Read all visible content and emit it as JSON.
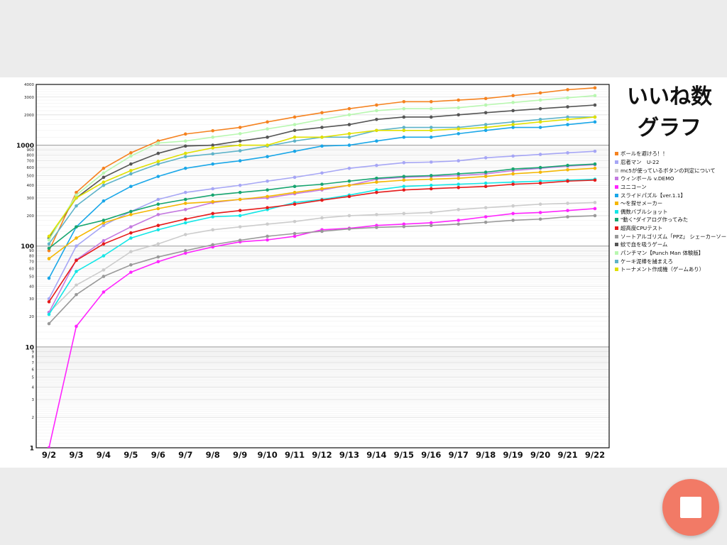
{
  "header": {
    "title_line1": "いいね数",
    "title_line2": "グラフ"
  },
  "stop_button": {
    "icon": "stop-icon"
  },
  "chart_data": {
    "type": "line",
    "yscale": "log",
    "ylim": [
      1,
      4000
    ],
    "grid": true,
    "legend_position": "right",
    "major_ticks": [
      "1",
      "10",
      "100",
      "1000"
    ],
    "minor_ticks": [
      "2",
      "3",
      "4",
      "5",
      "6",
      "7",
      "8",
      "9",
      "20",
      "30",
      "40",
      "50",
      "60",
      "70",
      "80",
      "90",
      "200",
      "300",
      "400",
      "500",
      "600",
      "700",
      "800",
      "900",
      "2000",
      "3000",
      "4000"
    ],
    "categories": [
      "9/2",
      "9/3",
      "9/4",
      "9/5",
      "9/6",
      "9/7",
      "9/8",
      "9/9",
      "9/10",
      "9/11",
      "9/12",
      "9/13",
      "9/14",
      "9/15",
      "9/16",
      "9/17",
      "9/18",
      "9/19",
      "9/20",
      "9/21",
      "9/22"
    ],
    "series": [
      {
        "name": "ボールを避けろ！！",
        "color": "#f5821f",
        "values": [
          90,
          340,
          590,
          840,
          1100,
          1290,
          1390,
          1500,
          1700,
          1900,
          2100,
          2300,
          2500,
          2700,
          2700,
          2800,
          2900,
          3100,
          3300,
          3550,
          3700
        ]
      },
      {
        "name": "忍者マン　U-22",
        "color": "#a6a6f5",
        "values": [
          30,
          100,
          160,
          220,
          290,
          340,
          370,
          400,
          440,
          480,
          530,
          590,
          630,
          670,
          680,
          700,
          750,
          780,
          810,
          840,
          870
        ]
      },
      {
        "name": "mc5が使っているボタンの判定について",
        "color": "#cccccc",
        "values": [
          22,
          41,
          58,
          88,
          105,
          130,
          145,
          155,
          165,
          175,
          190,
          200,
          205,
          210,
          215,
          230,
          240,
          250,
          260,
          265,
          270
        ]
      },
      {
        "name": "ウィンボール v.DEMO",
        "color": "#c479e0",
        "values": [
          22,
          73,
          113,
          155,
          205,
          230,
          270,
          290,
          300,
          330,
          360,
          400,
          460,
          480,
          490,
          500,
          520,
          560,
          590,
          620,
          640
        ]
      },
      {
        "name": "ユニコーン",
        "color": "#ff24ff",
        "values": [
          1,
          16,
          35,
          55,
          70,
          85,
          98,
          110,
          115,
          125,
          145,
          150,
          160,
          165,
          170,
          180,
          195,
          210,
          215,
          225,
          235
        ]
      },
      {
        "name": "スライドパズル【ver.1.1】",
        "color": "#1aa7e8",
        "values": [
          48,
          155,
          280,
          390,
          490,
          590,
          650,
          700,
          770,
          870,
          980,
          1000,
          1100,
          1200,
          1200,
          1300,
          1400,
          1500,
          1500,
          1600,
          1700
        ]
      },
      {
        "name": "〜を探せメーカー",
        "color": "#f5b700",
        "values": [
          75,
          120,
          170,
          205,
          235,
          265,
          275,
          290,
          310,
          340,
          370,
          400,
          430,
          450,
          460,
          470,
          490,
          520,
          540,
          570,
          590
        ]
      },
      {
        "name": "偶数バブルショット",
        "color": "#12e6e6",
        "values": [
          21,
          56,
          80,
          120,
          145,
          170,
          195,
          200,
          230,
          270,
          290,
          320,
          360,
          390,
          400,
          410,
          420,
          430,
          440,
          450,
          460
        ]
      },
      {
        "name": "\"動く\"ダイアログ作ってみた",
        "color": "#17a570",
        "values": [
          95,
          155,
          180,
          220,
          260,
          290,
          320,
          340,
          360,
          390,
          410,
          440,
          470,
          490,
          500,
          520,
          540,
          580,
          600,
          630,
          650
        ]
      },
      {
        "name": "超高度CPUテスト",
        "color": "#e61a1a",
        "values": [
          28,
          72,
          105,
          135,
          160,
          185,
          210,
          225,
          240,
          260,
          285,
          310,
          340,
          360,
          370,
          380,
          390,
          410,
          420,
          440,
          450
        ]
      },
      {
        "name": "ソートアルゴリズム「PPZ」 シェーカーソート版",
        "color": "#999999",
        "values": [
          17,
          33,
          50,
          65,
          78,
          90,
          103,
          114,
          125,
          133,
          140,
          148,
          153,
          156,
          160,
          165,
          172,
          180,
          185,
          195,
          200
        ]
      },
      {
        "name": "蚊で血を吸うゲーム",
        "color": "#555555",
        "values": [
          120,
          300,
          480,
          650,
          830,
          980,
          1000,
          1100,
          1200,
          1400,
          1500,
          1600,
          1800,
          1900,
          1900,
          2000,
          2100,
          2200,
          2300,
          2400,
          2500
        ]
      },
      {
        "name": "パンチマン【Punch Man 体験版】",
        "color": "#b8f7b0",
        "values": [
          115,
          320,
          530,
          780,
          1050,
          1100,
          1200,
          1300,
          1450,
          1600,
          1800,
          2000,
          2200,
          2300,
          2300,
          2350,
          2500,
          2650,
          2800,
          2950,
          3100
        ]
      },
      {
        "name": "ケーキ泥棒を捕まえろ",
        "color": "#5fb3c9",
        "values": [
          105,
          250,
          400,
          520,
          650,
          770,
          820,
          880,
          980,
          1100,
          1200,
          1200,
          1400,
          1500,
          1500,
          1500,
          1600,
          1700,
          1800,
          1900,
          1900
        ]
      },
      {
        "name": "トーナメント作成機（ゲームあり）",
        "color": "#e0e000",
        "values": [
          125,
          300,
          430,
          560,
          690,
          830,
          940,
          1000,
          1000,
          1200,
          1200,
          1300,
          1400,
          1400,
          1400,
          1450,
          1500,
          1600,
          1700,
          1800,
          1900
        ]
      }
    ]
  }
}
